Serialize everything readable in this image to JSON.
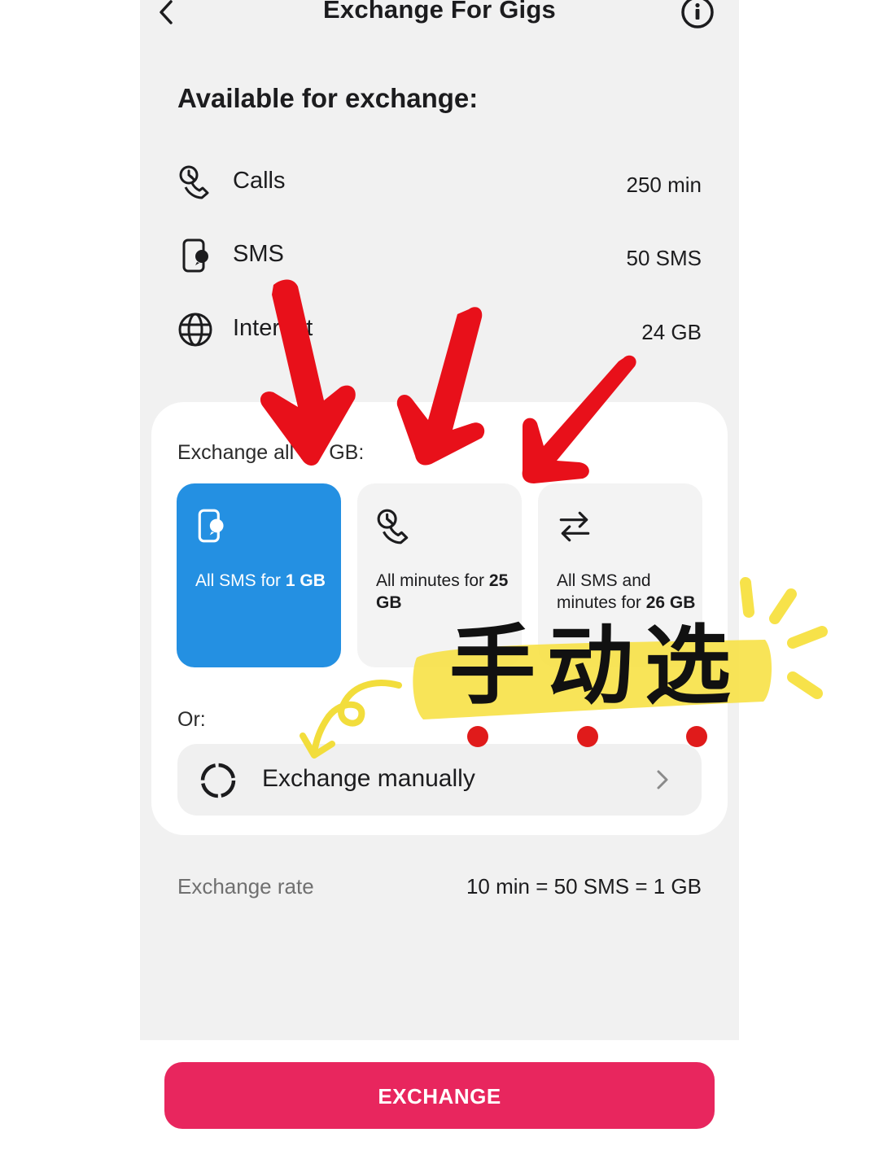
{
  "header": {
    "title": "Exchange For Gigs",
    "back_icon": "chevron-left-icon",
    "info_icon": "info-circle-icon"
  },
  "available": {
    "title": "Available for exchange:",
    "items": [
      {
        "label": "Calls",
        "value": "250 min",
        "icon": "phone-clock-icon"
      },
      {
        "label": "SMS",
        "value": "50 SMS",
        "icon": "sms-phone-icon"
      },
      {
        "label": "Internet",
        "value": "24 GB",
        "icon": "globe-icon"
      }
    ]
  },
  "exchange_all": {
    "title": "Exchange all for GB:",
    "options": [
      {
        "text": "All SMS for ",
        "amount": "1 GB",
        "icon": "sms-phone-icon",
        "selected": true
      },
      {
        "text": "All minutes for ",
        "amount": "25 GB",
        "icon": "phone-clock-icon",
        "selected": false
      },
      {
        "text": "All SMS and minutes for ",
        "amount": "26 GB",
        "icon": "swap-arrows-icon",
        "selected": false
      }
    ]
  },
  "manual": {
    "or_label": "Or:",
    "label": "Exchange manually",
    "icon": "ring-icon"
  },
  "rate": {
    "label": "Exchange rate",
    "value": "10 min = 50 SMS = 1 GB"
  },
  "action": {
    "button_label": "EXCHANGE"
  },
  "annotation": {
    "text": "手动选"
  },
  "colors": {
    "accent_blue": "#2490e2",
    "button_pink": "#e8265e",
    "arrow_red": "#e8101a",
    "highlight_yellow": "#f7e24a",
    "background": "#f1f1f1"
  }
}
